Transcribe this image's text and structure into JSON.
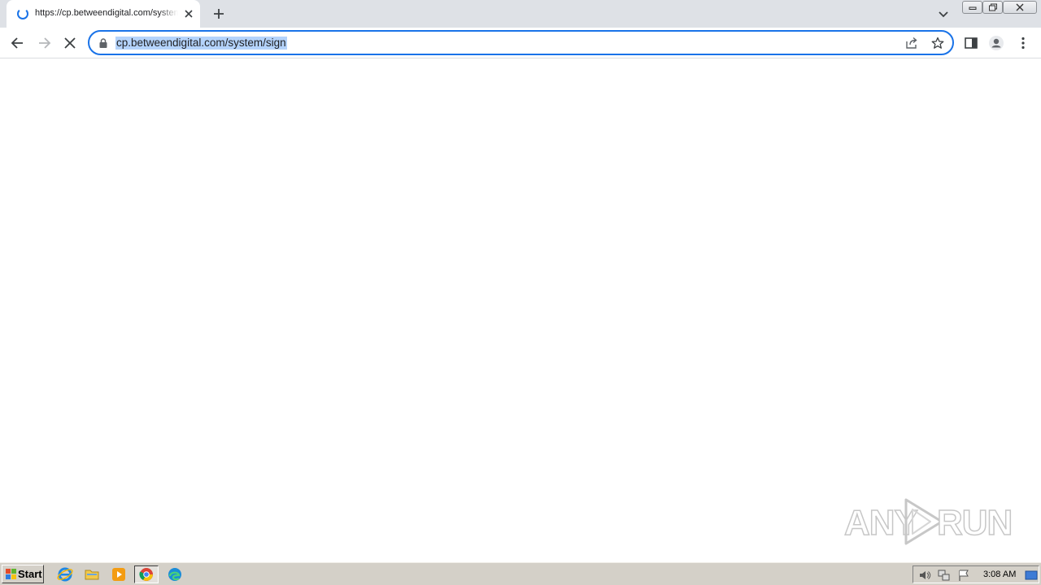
{
  "browser": {
    "tab": {
      "title": "https://cp.betweendigital.com/system/sign",
      "loading": true
    },
    "address_bar": {
      "url": "cp.betweendigital.com/system/sign",
      "selected": true
    },
    "accent_color": "#1a73e8"
  },
  "watermark": {
    "text_left": "ANY",
    "text_right": "RUN"
  },
  "taskbar": {
    "start_label": "Start",
    "apps": [
      "internet-explorer-icon",
      "file-explorer-icon",
      "media-player-icon",
      "chrome-icon",
      "edge-icon"
    ],
    "active_app": "chrome-icon",
    "tray_icons": [
      "speaker-icon",
      "network-icon",
      "flag-icon"
    ],
    "clock": "3:08 AM"
  }
}
